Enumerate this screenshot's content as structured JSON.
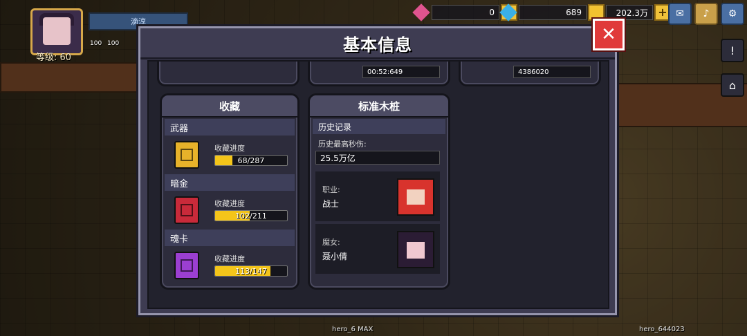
{
  "hud": {
    "level": "等级: 60",
    "name_bar": "滴淳",
    "badge_left": "100",
    "badge_right": "100",
    "resources": [
      {
        "name": "pink-gem",
        "value": "0",
        "color": "#e0548f"
      },
      {
        "name": "blue-gem",
        "value": "689",
        "color": "#3ab0e6"
      },
      {
        "name": "gold-coin",
        "value": "202.3万",
        "color": "#f2c230"
      }
    ],
    "plus_symbol": "+",
    "bottom_left": "hero_6 MAX",
    "bottom_right": "hero_644023"
  },
  "modal": {
    "title": "基本信息",
    "close_symbol": "✕",
    "top_stats": [
      "00:52:649",
      "4386020"
    ]
  },
  "collection": {
    "header": "收藏",
    "progress_label": "收藏进度",
    "categories": [
      {
        "name": "武器",
        "progress_text": "68/287",
        "progress": 0.237,
        "icon": "weapon-icon",
        "color": "#e7b22a"
      },
      {
        "name": "暗金",
        "progress_text": "102/211",
        "progress": 0.483,
        "icon": "dark-gold-icon",
        "color": "#c92a3a"
      },
      {
        "name": "魂卡",
        "progress_text": "113/147",
        "progress": 0.769,
        "icon": "soul-card-icon",
        "color": "#9b3fd1"
      }
    ]
  },
  "dummy": {
    "header": "标准木桩",
    "history_header": "历史记录",
    "dps_label": "历史最高秒伤:",
    "dps_value": "25.5万亿",
    "class_label": "职业:",
    "class_value": "战士",
    "witch_label": "魔女:",
    "witch_value": "聂小倩"
  }
}
